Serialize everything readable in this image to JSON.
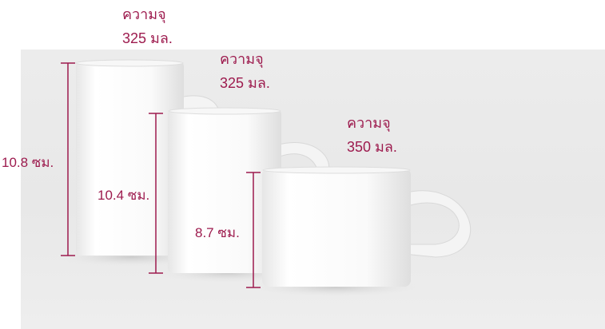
{
  "accent_color": "#9d1b4e",
  "mugs": [
    {
      "capacity_label": "ความจุ",
      "capacity_value": "325 มล.",
      "height_label": "10.8 ซม."
    },
    {
      "capacity_label": "ความจุ",
      "capacity_value": "325 มล.",
      "height_label": "10.4 ซม."
    },
    {
      "capacity_label": "ความจุ",
      "capacity_value": "350 มล.",
      "height_label": "8.7 ซม."
    }
  ]
}
